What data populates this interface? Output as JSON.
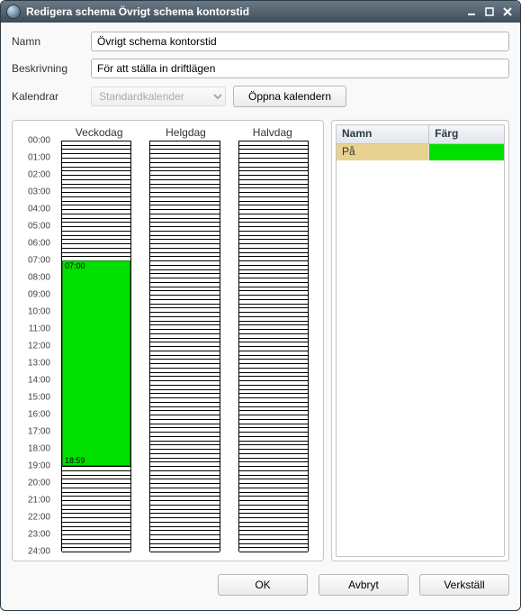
{
  "window": {
    "title": "Redigera schema Övrigt schema kontorstid"
  },
  "form": {
    "name_label": "Namn",
    "name_value": "Övrigt schema kontorstid",
    "desc_label": "Beskrivning",
    "desc_value": "För att ställa in driftlägen",
    "cal_label": "Kalendrar",
    "cal_selected": "Standardkalender",
    "open_cal_label": "Öppna kalendern"
  },
  "schedule": {
    "columns": [
      "Veckodag",
      "Helgdag",
      "Halvdag"
    ],
    "hours": [
      "00:00",
      "01:00",
      "02:00",
      "03:00",
      "04:00",
      "05:00",
      "06:00",
      "07:00",
      "08:00",
      "09:00",
      "10:00",
      "11:00",
      "12:00",
      "13:00",
      "14:00",
      "15:00",
      "16:00",
      "17:00",
      "18:00",
      "19:00",
      "20:00",
      "21:00",
      "22:00",
      "23:00",
      "24:00"
    ],
    "hour_count": 24,
    "subdivisions_per_hour": 3,
    "event": {
      "column": "Veckodag",
      "start_label": "07:00",
      "end_label": "18:59",
      "start_hour": 7.0,
      "end_hour": 19.0,
      "color": "#00e000"
    }
  },
  "side": {
    "headers": {
      "name": "Namn",
      "color": "Färg"
    },
    "rows": [
      {
        "name": "På",
        "color": "#00e000",
        "selected": true
      }
    ]
  },
  "footer": {
    "ok": "OK",
    "cancel": "Avbryt",
    "apply": "Verkställ"
  }
}
